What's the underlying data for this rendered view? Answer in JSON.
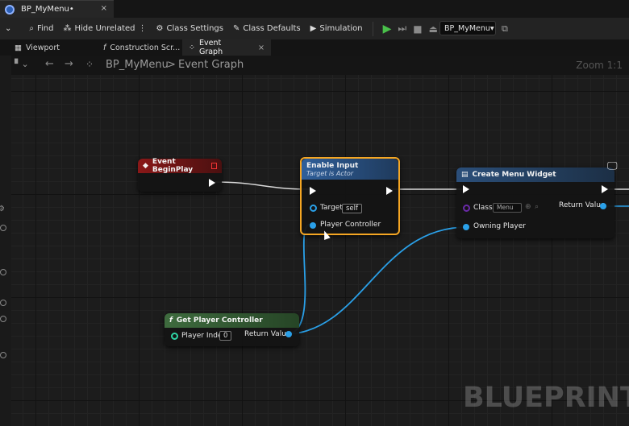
{
  "window": {
    "tab_title": "BP_MyMenu•",
    "tab_close": "×"
  },
  "toolbar": {
    "find": "Find",
    "hide_unrelated": "Hide Unrelated",
    "class_settings": "Class Settings",
    "class_defaults": "Class Defaults",
    "simulation": "Simulation",
    "debug_object": "BP_MyMenu"
  },
  "panel_tabs": [
    {
      "label": "Viewport"
    },
    {
      "label": "Construction Scr..."
    },
    {
      "label": "Event Graph",
      "close": "×"
    }
  ],
  "breadcrumb": {
    "blueprint": "BP_MyMenu",
    "separator": ">",
    "graph": "Event Graph",
    "zoom": "Zoom 1:1"
  },
  "nodes": {
    "begin_play": {
      "title": "Event BeginPlay"
    },
    "enable_input": {
      "title": "Enable Input",
      "subtitle": "Target is Actor",
      "target_label": "Target",
      "target_value": "self",
      "player_controller_label": "Player Controller"
    },
    "create_widget": {
      "title": "Create Menu Widget",
      "class_label": "Class",
      "class_value": "Menu",
      "return_label": "Return Value",
      "owning_player_label": "Owning Player"
    },
    "get_player_controller": {
      "title": "Get Player Controller",
      "player_index_label": "Player Index",
      "player_index_value": "0",
      "return_label": "Return Value"
    }
  },
  "watermark": "BLUEPRINT",
  "colors": {
    "exec_wire": "#d9d9d9",
    "object_wire": "#2aa0e8",
    "selection": "#f5a623",
    "event_header": "#8a1818",
    "function_header": "#2f5f9a",
    "pure_header": "#3e6b3e"
  }
}
